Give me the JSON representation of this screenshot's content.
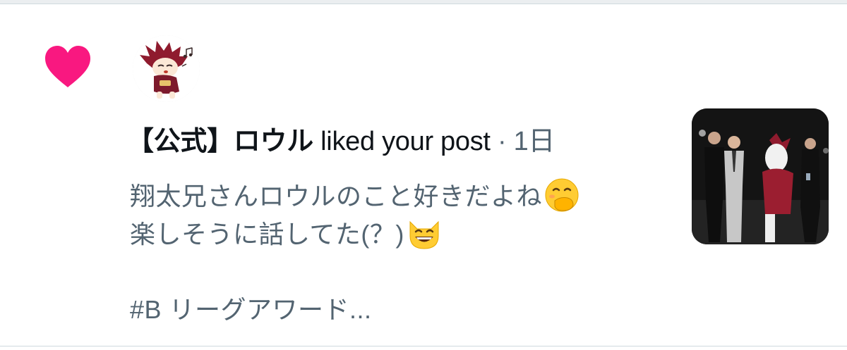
{
  "notification": {
    "type_icon": "heart-icon",
    "like_color": "#f91880",
    "user_name": "【公式】ロウル",
    "action": " liked your post",
    "separator": " · ",
    "timestamp": "1日",
    "post_text": {
      "line1": "翔太兄さんロウルのこと好きだよね",
      "line1_emoji": "face-with-hand-over-mouth-emoji",
      "line2": "楽しそうに話してた(？)",
      "line2_emoji": "grinning-cat-emoji",
      "line3": "#B リーグアワード..."
    },
    "avatar_icon": "mascot-avatar",
    "media": "post-media-thumbnail"
  }
}
